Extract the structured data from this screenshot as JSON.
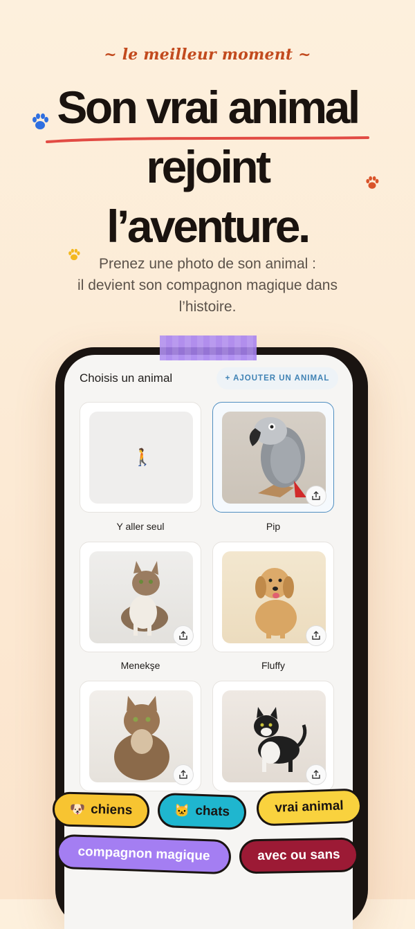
{
  "hero": {
    "tagline": "~ le meilleur moment ~",
    "headline_line1": "Son vrai animal",
    "headline_line2": "rejoint",
    "headline_line3": "l’aventure.",
    "subtitle_line1": "Prenez une photo de son animal :",
    "subtitle_line2": "il devient son compagnon magique dans",
    "subtitle_line3": "l’histoire."
  },
  "screen": {
    "title": "Choisis un animal",
    "add_button_label": "+ AJOUTER UN ANIMAL",
    "selected": "Pip",
    "animals": [
      {
        "label": "Y aller seul",
        "icon": "person-walking-icon"
      },
      {
        "label": "Pip",
        "icon": "parrot-photo"
      },
      {
        "label": "Menekşe",
        "icon": "tabby-cat-photo"
      },
      {
        "label": "Fluffy",
        "icon": "golden-retriever-photo"
      },
      {
        "label": "",
        "icon": "maine-coon-photo"
      },
      {
        "label": "",
        "icon": "tuxedo-cat-photo"
      }
    ]
  },
  "tags": [
    {
      "label": "chiens",
      "emoji": "🐶",
      "color": "#f7c431"
    },
    {
      "label": "chats",
      "emoji": "🐱",
      "color": "#1fb6cf"
    },
    {
      "label": "vrai animal",
      "emoji": "",
      "color": "#f9d23e"
    },
    {
      "label": "compagnon magique",
      "emoji": "",
      "color": "#a47ef2"
    },
    {
      "label": "avec ou sans",
      "emoji": "",
      "color": "#9c1a35"
    }
  ],
  "colors": {
    "accent_orange": "#c24a1e",
    "underline_red": "#e24b44",
    "tape_purple": "#a682f0",
    "link_blue": "#3f82b4",
    "paw_blue": "#2f6fe0",
    "paw_orange": "#d9542a",
    "paw_yellow": "#f3b81f"
  }
}
